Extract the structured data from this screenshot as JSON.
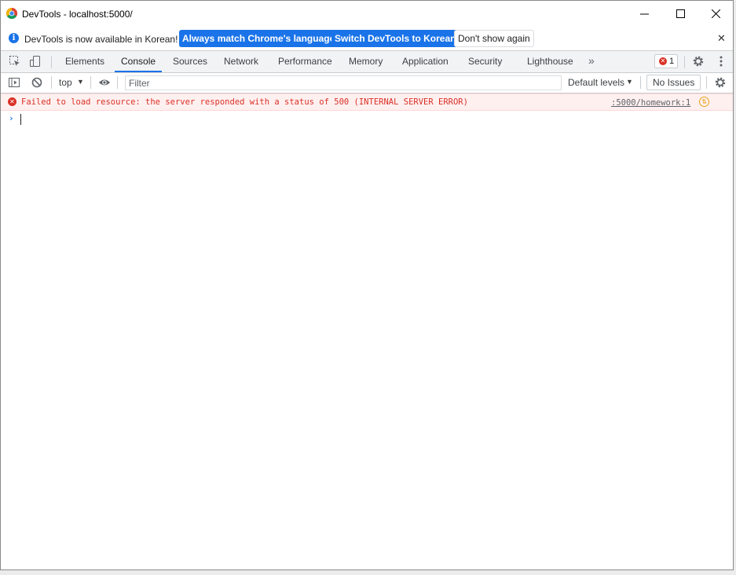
{
  "window": {
    "title": "DevTools - localhost:5000/",
    "minimize_glyph": "—",
    "maximize_glyph": "☐",
    "close_glyph": "✕"
  },
  "infobar": {
    "icon": "info-icon",
    "message": "DevTools is now available in Korean!",
    "match_language_label": "Always match Chrome's language",
    "switch_label": "Switch DevTools to Korean",
    "dismiss_label": "Don't show again",
    "close_glyph": "✕"
  },
  "tabs": {
    "items": [
      {
        "label": "Elements",
        "active": false
      },
      {
        "label": "Console",
        "active": true
      },
      {
        "label": "Sources",
        "active": false
      },
      {
        "label": "Network",
        "active": false
      },
      {
        "label": "Performance",
        "active": false
      },
      {
        "label": "Memory",
        "active": false
      },
      {
        "label": "Application",
        "active": false
      },
      {
        "label": "Security",
        "active": false
      },
      {
        "label": "Lighthouse",
        "active": false
      }
    ],
    "more_glyph": "»",
    "error_count": "1"
  },
  "console_toolbar": {
    "context": "top",
    "filter_placeholder": "Filter",
    "levels_label": "Default levels",
    "issues_label": "No Issues"
  },
  "console": {
    "messages": [
      {
        "level": "error",
        "text": "Failed to load resource: the server responded with a status of 500 (INTERNAL SERVER ERROR)",
        "source": ":5000/homework:1"
      }
    ],
    "prompt_glyph": "›"
  },
  "colors": {
    "accent": "#1a73e8",
    "error": "#d93025",
    "error_bg": "#fff0f0"
  }
}
